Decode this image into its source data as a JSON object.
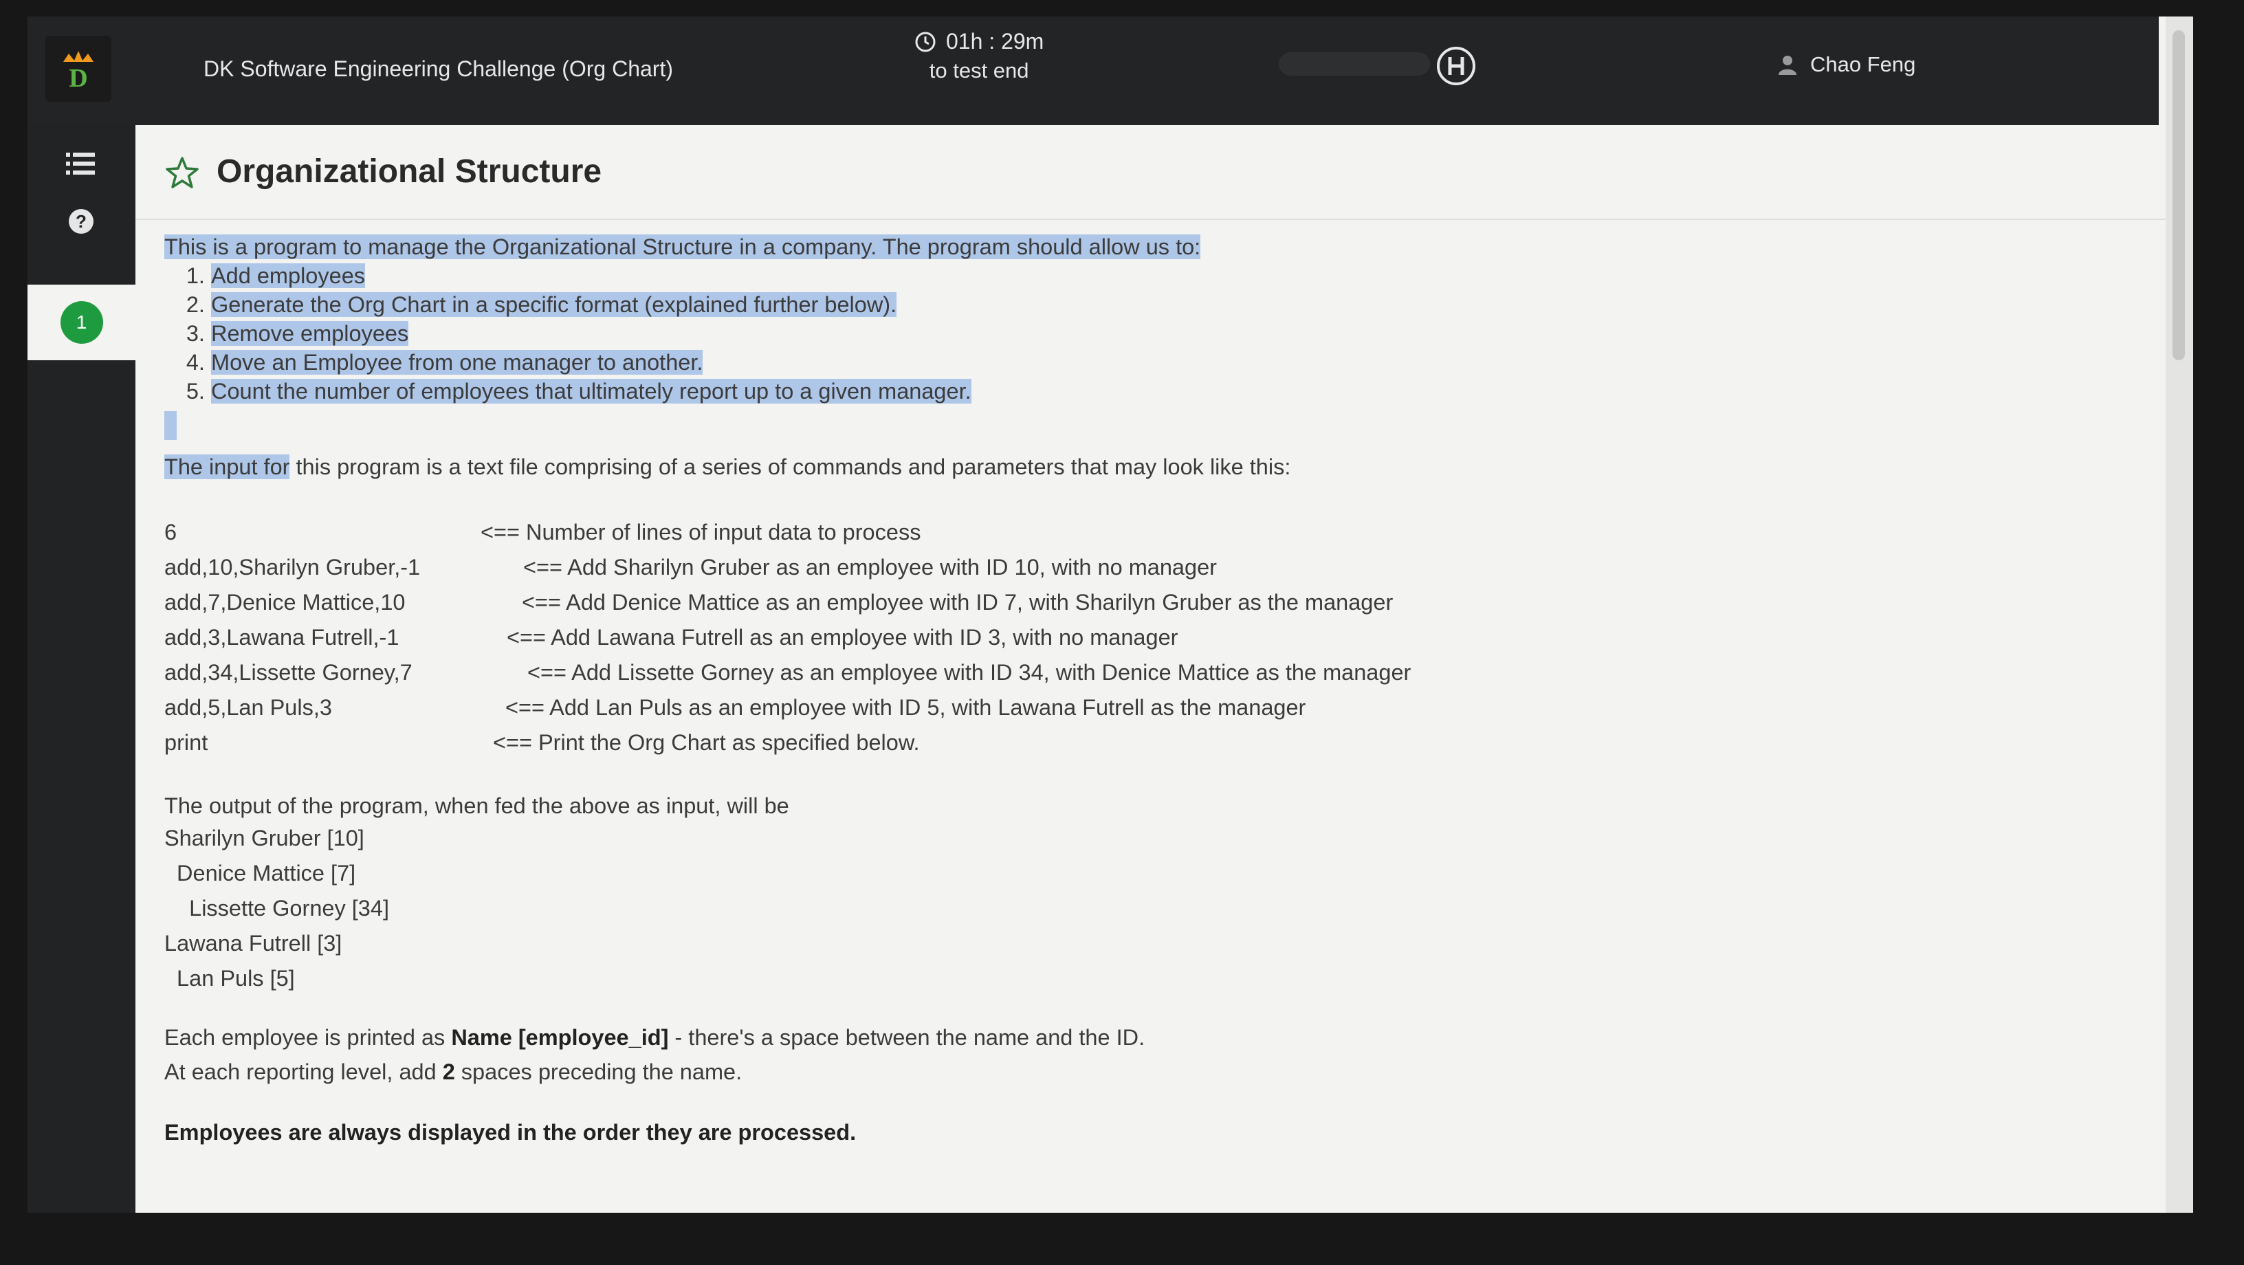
{
  "topbar": {
    "test_title": "DK Software Engineering Challenge (Org Chart)",
    "timer": "01h : 29m",
    "timer_sub": "to test end",
    "user_name": "Chao Feng"
  },
  "sidebar": {
    "question_number": "1"
  },
  "question": {
    "title": "Organizational Structure",
    "intro": "This is a program to manage the Organizational Structure in a company. The program should allow us to:",
    "steps": [
      "Add employees",
      "Generate the Org Chart in a specific format (explained further below).",
      "Remove employees",
      "Move an Employee from one manager to another.",
      "Count the number of employees that ultimately report up to a given manager."
    ],
    "input_selected": "The input for",
    "input_rest": " this program is a text file comprising of a series of commands and parameters that may look like this:",
    "commands": [
      {
        "code": "6",
        "note": "<== Number of lines of input data to process"
      },
      {
        "code": "add,10,Sharilyn Gruber,-1",
        "note": "<== Add Sharilyn Gruber as an employee with ID 10, with no manager"
      },
      {
        "code": "add,7,Denice Mattice,10",
        "note": "<== Add Denice Mattice as an employee with ID 7, with Sharilyn Gruber as the manager"
      },
      {
        "code": "add,3,Lawana Futrell,-1",
        "note": "<== Add Lawana Futrell as an employee with ID 3, with no manager"
      },
      {
        "code": "add,34,Lissette Gorney,7",
        "note": "<== Add Lissette Gorney as an employee with ID 34, with Denice Mattice as the manager"
      },
      {
        "code": "add,5,Lan Puls,3",
        "note": "<== Add Lan Puls as an employee with ID 5, with Lawana Futrell as the manager"
      },
      {
        "code": "print",
        "note": "<== Print the Org Chart as specified below."
      }
    ],
    "output_intro": "The output of the program, when fed the above as input, will be",
    "output_lines": [
      "Sharilyn Gruber [10]",
      "  Denice Mattice [7]",
      "    Lissette Gorney [34]",
      "Lawana Futrell [3]",
      "  Lan Puls [5]"
    ],
    "format_prefix": "Each employee is printed as ",
    "format_bold": "Name [employee_id]",
    "format_suffix": " - there's a space between the name and the ID.",
    "level_prefix": "At each reporting level, add ",
    "level_bold": "2",
    "level_suffix": " spaces preceding the name.",
    "order_note": "Employees are always displayed in the order they are processed."
  }
}
